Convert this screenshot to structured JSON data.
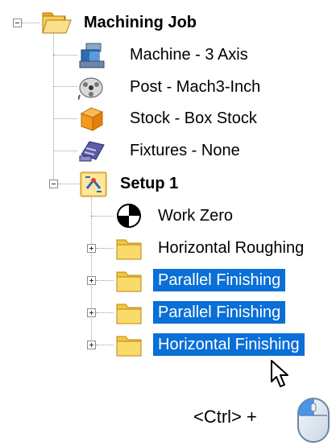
{
  "tree": {
    "root": {
      "label": "Machining Job"
    },
    "children": [
      {
        "label": "Machine - 3 Axis",
        "icon": "machine-icon"
      },
      {
        "label": "Post - Mach3-Inch",
        "icon": "post-reel-icon"
      },
      {
        "label": "Stock - Box Stock",
        "icon": "stock-box-icon"
      },
      {
        "label": "Fixtures - None",
        "icon": "fixtures-icon"
      }
    ],
    "setup": {
      "label": "Setup 1",
      "icon": "setup-icon",
      "children": [
        {
          "label": "Work Zero",
          "icon": "work-zero-icon"
        },
        {
          "label": "Horizontal Roughing",
          "icon": "folder-icon",
          "selected": false
        },
        {
          "label": "Parallel Finishing",
          "icon": "folder-icon",
          "selected": true
        },
        {
          "label": "Parallel Finishing",
          "icon": "folder-icon",
          "selected": true
        },
        {
          "label": "Horizontal Finishing",
          "icon": "folder-icon",
          "selected": true
        }
      ]
    }
  },
  "hint": {
    "text": "<Ctrl> +",
    "icon": "mouse-left-click-icon"
  },
  "colors": {
    "selection": "#0a6fd6",
    "folder": "#f5c342",
    "stock": "#f39a1e"
  }
}
